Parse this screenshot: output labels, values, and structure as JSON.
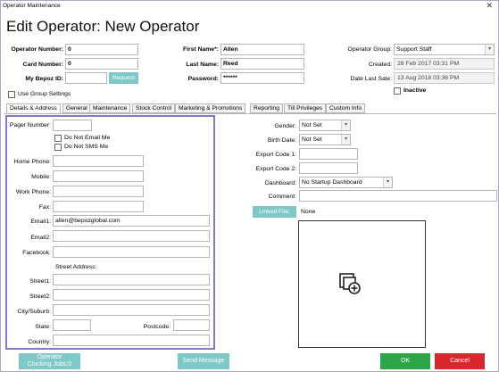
{
  "window": {
    "title": "Operator Maintenance",
    "close_glyph": "✕"
  },
  "heading": "Edit Operator: New Operator",
  "header": {
    "operator_number_label": "Operator Number:",
    "operator_number_value": "0",
    "card_number_label": "Card Number:",
    "card_number_value": "0",
    "mybepoz_label": "My Bepoz ID:",
    "mybepoz_value": "",
    "request_label": "Request",
    "first_name_label": "First Name*:",
    "first_name_value": "Allen",
    "last_name_label": "Last Name:",
    "last_name_value": "Reed",
    "password_label": "Password:",
    "password_value": "******",
    "operator_group_label": "Operator Group:",
    "operator_group_value": "Support Staff",
    "created_label": "Created:",
    "created_value": "28 Feb 2017 03:31 PM",
    "date_last_sale_label": "Date Last Sale:",
    "date_last_sale_value": "13 Aug 2018 03:36 PM",
    "inactive_label": "Inactive",
    "use_group_settings_label": "Use Group Settings"
  },
  "tabs": [
    {
      "label": "Details & Address"
    },
    {
      "label": "General"
    },
    {
      "label": "Maintenance"
    },
    {
      "label": "Stock Control"
    },
    {
      "label": "Marketing & Promotions"
    },
    {
      "label": "Reporting"
    },
    {
      "label": "Till Privileges"
    },
    {
      "label": "Custom Info"
    }
  ],
  "details": {
    "pager_label": "Pager Number:",
    "no_email_label": "Do Not Email Me",
    "no_sms_label": "Do Not SMS Me",
    "home_phone_label": "Home Phone:",
    "mobile_label": "Mobile:",
    "work_phone_label": "Work Phone:",
    "fax_label": "Fax:",
    "email1_label": "Email1:",
    "email1_value": "allen@bepozglobal.com",
    "email2_label": "Email2:",
    "facebook_label": "Facebook:",
    "street_address_label": "Street Address:",
    "street1_label": "Street1:",
    "street2_label": "Street2:",
    "city_label": "City/Suburb:",
    "state_label": "State:",
    "postcode_label": "Postcode:",
    "country_label": "Country:"
  },
  "right": {
    "gender_label": "Gender:",
    "gender_value": "Not Set",
    "birth_date_label": "Birth Date:",
    "birth_date_value": "Not Set",
    "export1_label": "Export Code 1:",
    "export2_label": "Export Code 2:",
    "dashboard_label": "Dashboard:",
    "dashboard_value": "No Startup Dashboard",
    "comment_label": "Comment:",
    "linked_file_label": "Linked File:",
    "linked_file_value": "None"
  },
  "footer": {
    "clocking_label_1": "Operator",
    "clocking_label_2": "Clocking Jobs:0",
    "send_message_label": "Send Message",
    "ok_label": "OK",
    "cancel_label": "Cancel"
  },
  "colors": {
    "teal": "#7ec8c8",
    "ok_green": "#2fa54a",
    "cancel_red": "#d9272e",
    "highlight_border": "#8478c8"
  }
}
